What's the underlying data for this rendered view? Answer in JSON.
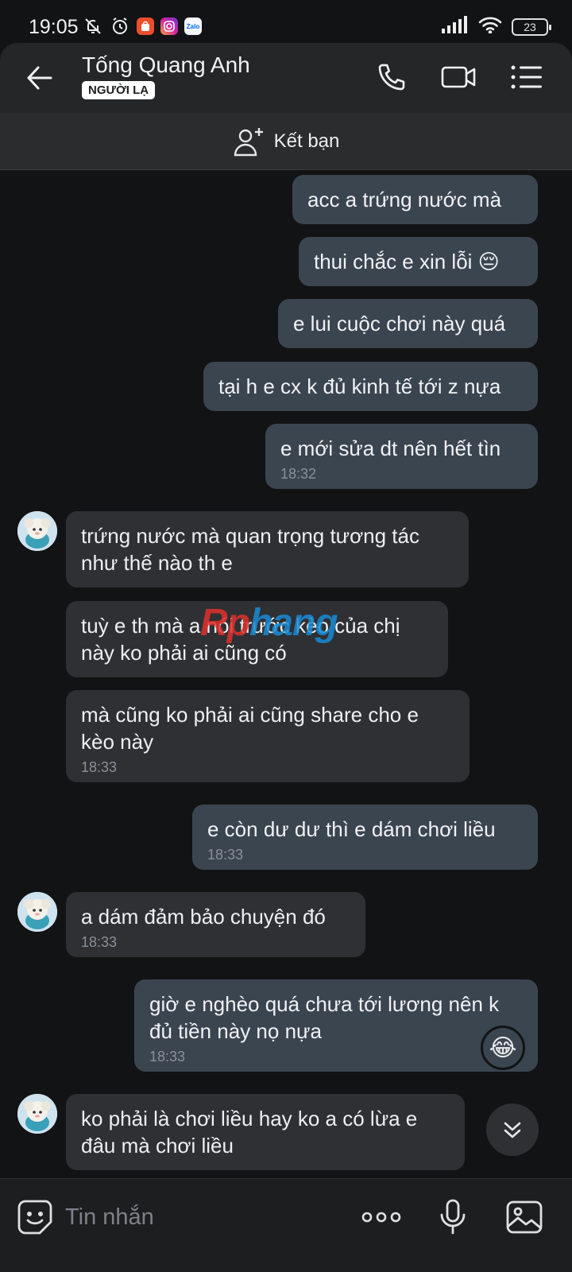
{
  "status_bar": {
    "time": "19:05",
    "battery": "23",
    "icons": [
      "mute-bell-icon",
      "alarm-icon",
      "shopee-app-icon",
      "instagram-app-icon",
      "zalo-app-icon",
      "signal-icon",
      "wifi-icon",
      "battery-icon"
    ],
    "zalo_label": "Zalo"
  },
  "header": {
    "name": "Tống Quang Anh",
    "badge": "NGƯỜI LẠ"
  },
  "add_friend": {
    "label": "Kết bạn"
  },
  "watermark": {
    "part1": "Rp",
    "part2": "hang"
  },
  "messages": [
    {
      "side": "out",
      "text": "acc a trứng nước mà",
      "time": ""
    },
    {
      "side": "out",
      "text": "thui chắc e xin lỗi 😔",
      "time": ""
    },
    {
      "side": "out",
      "text": "e lui cuộc chơi này quá",
      "time": ""
    },
    {
      "side": "out",
      "text": "tại h e cx k đủ kinh tế tới z nựa",
      "time": ""
    },
    {
      "side": "out",
      "text": "e mới sửa dt nên hết tìn",
      "time": "18:32"
    },
    {
      "side": "in",
      "text": "trứng nước mà quan trọng tương tác\nnhư thế nào th e",
      "time": ""
    },
    {
      "side": "in",
      "text": "tuỳ e th mà a nói trước kèo của chị\nnày ko phải ai cũng có",
      "time": ""
    },
    {
      "side": "in",
      "text": "mà cũng ko phải ai cũng share cho e\nkèo này",
      "time": "18:33"
    },
    {
      "side": "out",
      "text": "e còn dư dư thì e dám chơi liều",
      "time": "18:33"
    },
    {
      "side": "in",
      "text": "a dám đảm bảo chuyện đó",
      "time": "18:33"
    },
    {
      "side": "out",
      "text": "giờ e nghèo quá chưa tới lương nên k\nđủ tiền này nọ nựa",
      "time": "18:33",
      "reaction": "😂"
    },
    {
      "side": "in",
      "text": "ko phải là chơi liều hay ko a có lừa e\nđâu mà chơi liều",
      "time": ""
    }
  ],
  "input": {
    "placeholder": "Tin nhắn"
  },
  "colors": {
    "background": "#121314",
    "outgoing_bubble": "#3b4550",
    "incoming_bubble": "#2e3033",
    "header": "#242628"
  }
}
